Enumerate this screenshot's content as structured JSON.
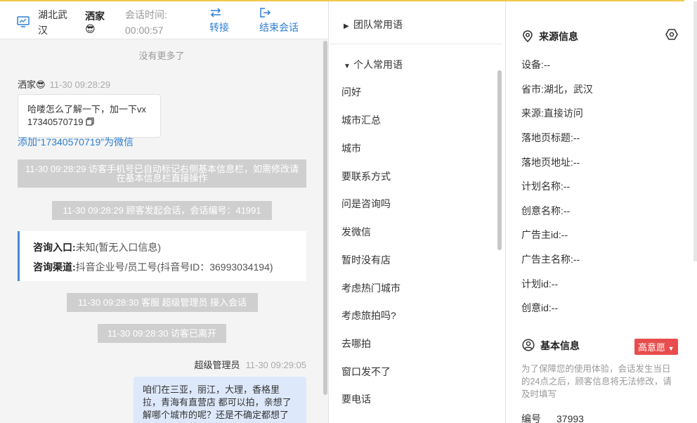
{
  "header": {
    "location": "湖北武汉",
    "visitor_name": "洒家😎",
    "session_label": "会话时间:",
    "session_time": "00:00:57",
    "transfer_label": "转接",
    "end_label": "结束会话"
  },
  "chat": {
    "no_more": "没有更多了",
    "visitor_msg": {
      "name": "洒家😎",
      "time": "11-30 09:28:29",
      "line1": "哈喽怎么了解一下，加一下vx",
      "line2": "17340570719"
    },
    "wx_link": "添加“17340570719”为微信",
    "sys1": "11-30 09:28:29 访客手机号已自动标记右侧基本信息栏，如需修改请在基本信息栏直接操作",
    "sys2": "11-30 09:28:29 顾客发起会话，会话编号：41991",
    "entry": {
      "label1": "咨询入口:",
      "value1": "未知(暂无入口信息)",
      "label2": "咨询渠道:",
      "value2": "抖音企业号/员工号(抖音号ID：36993034194)"
    },
    "sys3": "11-30 09:28:30 客服 超级管理员 接入会话",
    "sys4": "11-30 09:28:30 访客已离开",
    "agent_msg": {
      "name": "超级管理员",
      "time": "11-30 09:29:05",
      "text": "咱们在三亚，丽江，大理，香格里拉，青海有直营店 都可以拍，亲想了解哪个城市的呢？还是不确定都想了解一下价格范围呢？"
    }
  },
  "phrases": {
    "team_group": "团队常用语",
    "personal_group": "个人常用语",
    "items": [
      "问好",
      "城市汇总",
      "城市",
      "要联系方式",
      "问是咨询吗",
      "发微信",
      "暂时没有店",
      "考虑热门城市",
      "考虑旅拍吗?",
      "去哪拍",
      "窗口发不了",
      "要电话"
    ]
  },
  "source_info": {
    "title": "来源信息",
    "fields": [
      {
        "label": "设备:",
        "value": "--"
      },
      {
        "label": "省市:",
        "value": "湖北，武汉"
      },
      {
        "label": "来源:",
        "value": "直接访问"
      },
      {
        "label": "落地页标题:",
        "value": "--"
      },
      {
        "label": "落地页地址:",
        "value": "--"
      },
      {
        "label": "计划名称:",
        "value": "--"
      },
      {
        "label": "创意名称:",
        "value": "--"
      },
      {
        "label": "广告主id:",
        "value": "--"
      },
      {
        "label": "广告主名称:",
        "value": "--"
      },
      {
        "label": "计划id:",
        "value": "--"
      },
      {
        "label": "创意id:",
        "value": "--"
      }
    ]
  },
  "basic_info": {
    "title": "基本信息",
    "badge": "高意愿",
    "note": "为了保障您的使用体验，会话发生当日的24点之后，顾客信息将无法修改，请及时填写",
    "id_label": "编号",
    "id_value": "37993"
  },
  "colors": {
    "accent": "#2f7fd3",
    "badge": "#e94c4c",
    "agent_bubble": "#dde9fb",
    "system": "#cfcfcf"
  }
}
